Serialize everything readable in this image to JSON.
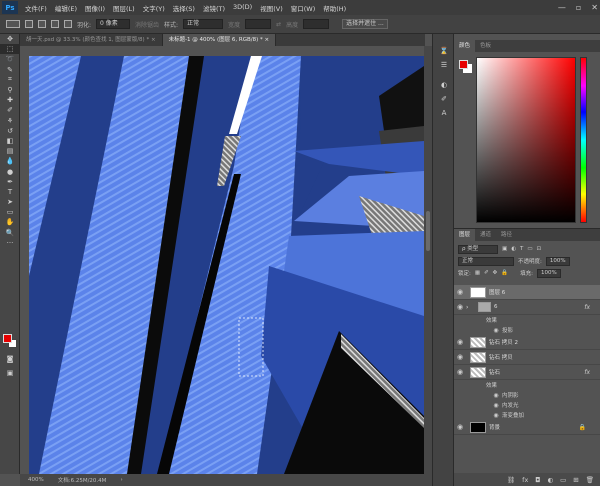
{
  "app": {
    "logo": "Ps"
  },
  "menu": [
    "文件(F)",
    "编辑(E)",
    "图像(I)",
    "图层(L)",
    "文字(Y)",
    "选择(S)",
    "滤镜(T)",
    "3D(D)",
    "视图(V)",
    "窗口(W)",
    "帮助(H)"
  ],
  "window_controls": [
    "—",
    "▫",
    "✕"
  ],
  "options": {
    "feather_label": "羽化:",
    "feather_value": "0 像素",
    "antialias_label": "消除锯齿",
    "style_label": "样式:",
    "style_value": "正常",
    "width_label": "宽度",
    "height_label": "高度",
    "select_mask_button": "选择并遮住 ..."
  },
  "tabs": [
    {
      "label": "胡一天.psd @ 33.3% (颜色查找 1, 图层蒙版/8) *  ×",
      "active": false
    },
    {
      "label": "未标题-1 @ 400% (图层 6, RGB/8) *  ×",
      "active": true
    }
  ],
  "status": {
    "zoom": "400%",
    "doc": "文档:6.25M/20.4M"
  },
  "color_panel": {
    "tabs": [
      "颜色",
      "色板"
    ],
    "fg_color": "#e60000",
    "bg_color": "#ffffff"
  },
  "layers_panel": {
    "tabs": [
      "图层",
      "通道",
      "路径"
    ],
    "kind_filter": "ρ 类型",
    "blend_mode": "正常",
    "opacity_label": "不透明度:",
    "opacity_value": "100%",
    "lock_label": "锁定:",
    "fill_label": "填充:",
    "fill_value": "100%",
    "layers": [
      {
        "name": "图层 6",
        "thumb": "white",
        "selected": true
      },
      {
        "name": "6",
        "thumb": "folder",
        "fx": "fx",
        "effects_header": "效果",
        "effects": [
          "投影"
        ]
      },
      {
        "name": "钻石 拷贝 2",
        "thumb": "check"
      },
      {
        "name": "钻石 拷贝",
        "thumb": "check"
      },
      {
        "name": "钻石",
        "thumb": "check",
        "fx": "fx",
        "effects_header": "效果",
        "effects": [
          "内阴影",
          "内发光",
          "渐变叠加"
        ]
      },
      {
        "name": "背景",
        "thumb": "black",
        "lock": "🔒"
      }
    ],
    "bottom_icons": [
      "link-icon",
      "fx-icon",
      "mask-icon",
      "adjustment-icon",
      "folder-icon",
      "new-layer-icon",
      "trash-icon"
    ]
  }
}
